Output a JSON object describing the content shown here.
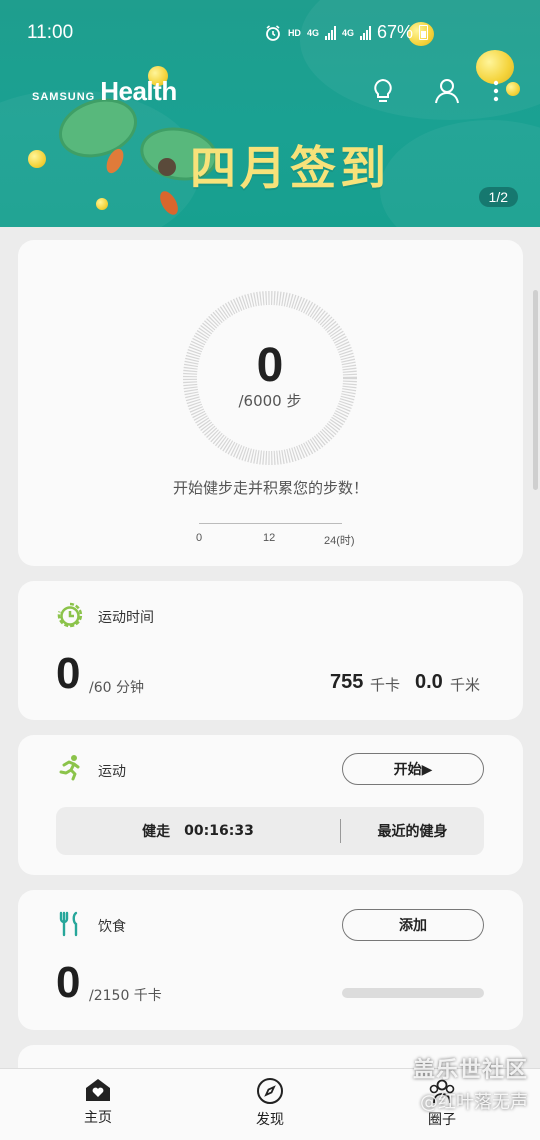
{
  "status_bar": {
    "time": "11:00",
    "hd": "HD",
    "net1": "4G",
    "net2": "4G",
    "battery_pct": "67%"
  },
  "header": {
    "brand_small": "SAMSUNG",
    "brand_large": "Health",
    "banner_title": "四月签到",
    "page_indicator": "1/2",
    "icons": [
      "lightbulb-icon",
      "profile-icon",
      "more-icon"
    ]
  },
  "steps": {
    "count": "0",
    "goal": "/6000 步",
    "message": "开始健步走并积累您的步数！",
    "axis": [
      "0",
      "12",
      "24(时)"
    ],
    "progress": 0
  },
  "active_time": {
    "title": "运动时间",
    "value": "0",
    "goal": "/60 分钟",
    "kcal_value": "755",
    "kcal_unit": "千卡",
    "km_value": "0.0",
    "km_unit": "千米"
  },
  "exercise": {
    "title": "运动",
    "start_label": "开始▶",
    "recent_type": "健走",
    "recent_duration": "00:16:33",
    "recent_link": "最近的健身"
  },
  "food": {
    "title": "饮食",
    "add_label": "添加",
    "value": "0",
    "goal": "/2150 千卡",
    "progress": 0
  },
  "nav": {
    "home": "主页",
    "discover": "发现",
    "together": "圈子"
  },
  "watermark": {
    "line1": "盖乐世社区",
    "line2": "@红叶落无声"
  },
  "colors": {
    "banner": "#1aa192",
    "title_yellow": "#f7e27a",
    "accent_green": "#8bc34a"
  }
}
